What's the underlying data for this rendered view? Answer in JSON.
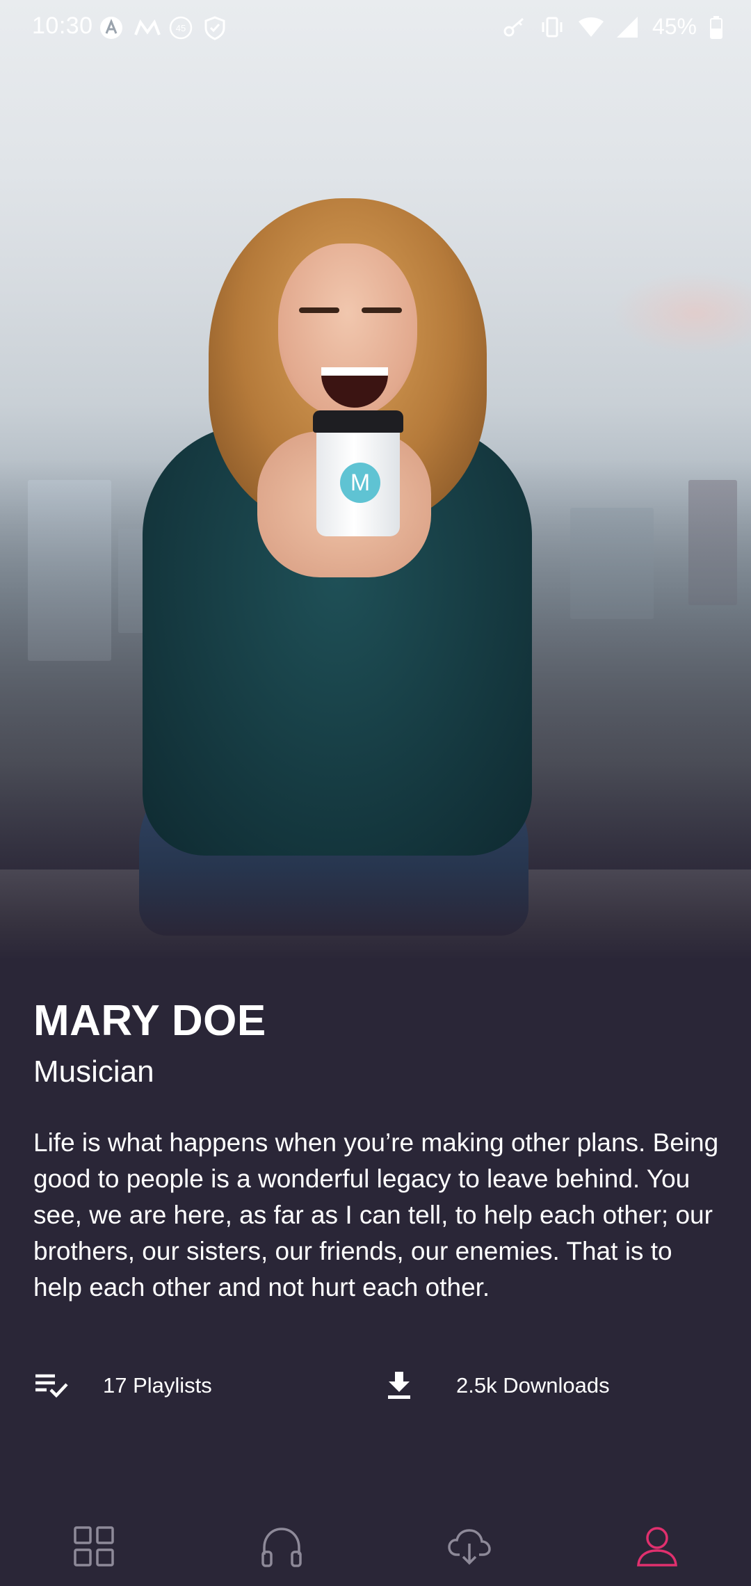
{
  "status_bar": {
    "time": "10:30",
    "battery": "45%",
    "left_icons": [
      "a-circle-icon",
      "m-icon",
      "data-45-icon",
      "shield-icon"
    ],
    "right_icons": [
      "key-icon",
      "vibrate-icon",
      "wifi-icon",
      "signal-icon",
      "battery-icon"
    ]
  },
  "hero": {
    "image": "woman-drinking-coffee-photo",
    "cup_logo_letter": "M"
  },
  "profile": {
    "name": "MARY DOE",
    "role": "Musician",
    "bio": "Life is what happens when you’re making other plans. Being good to people is a wonderful legacy to leave behind. You see, we are here, as far as I can tell, to help each other; our brothers, our sisters, our friends, our enemies. That is to help each other and not hurt each other."
  },
  "stats": {
    "playlists": {
      "label": "17 Playlists",
      "icon": "playlist-check-icon"
    },
    "downloads": {
      "label": "2.5k Downloads",
      "icon": "download-icon"
    }
  },
  "bottom_nav": {
    "items": [
      {
        "name": "grid",
        "icon": "grid-icon",
        "active": false
      },
      {
        "name": "listen",
        "icon": "headphones-icon",
        "active": false
      },
      {
        "name": "downloads",
        "icon": "cloud-download-icon",
        "active": false
      },
      {
        "name": "profile",
        "icon": "user-icon",
        "active": true
      }
    ]
  },
  "colors": {
    "background": "#2a2637",
    "text": "#ffffff",
    "nav_inactive": "#8e8a99",
    "accent": "#e0306e"
  }
}
